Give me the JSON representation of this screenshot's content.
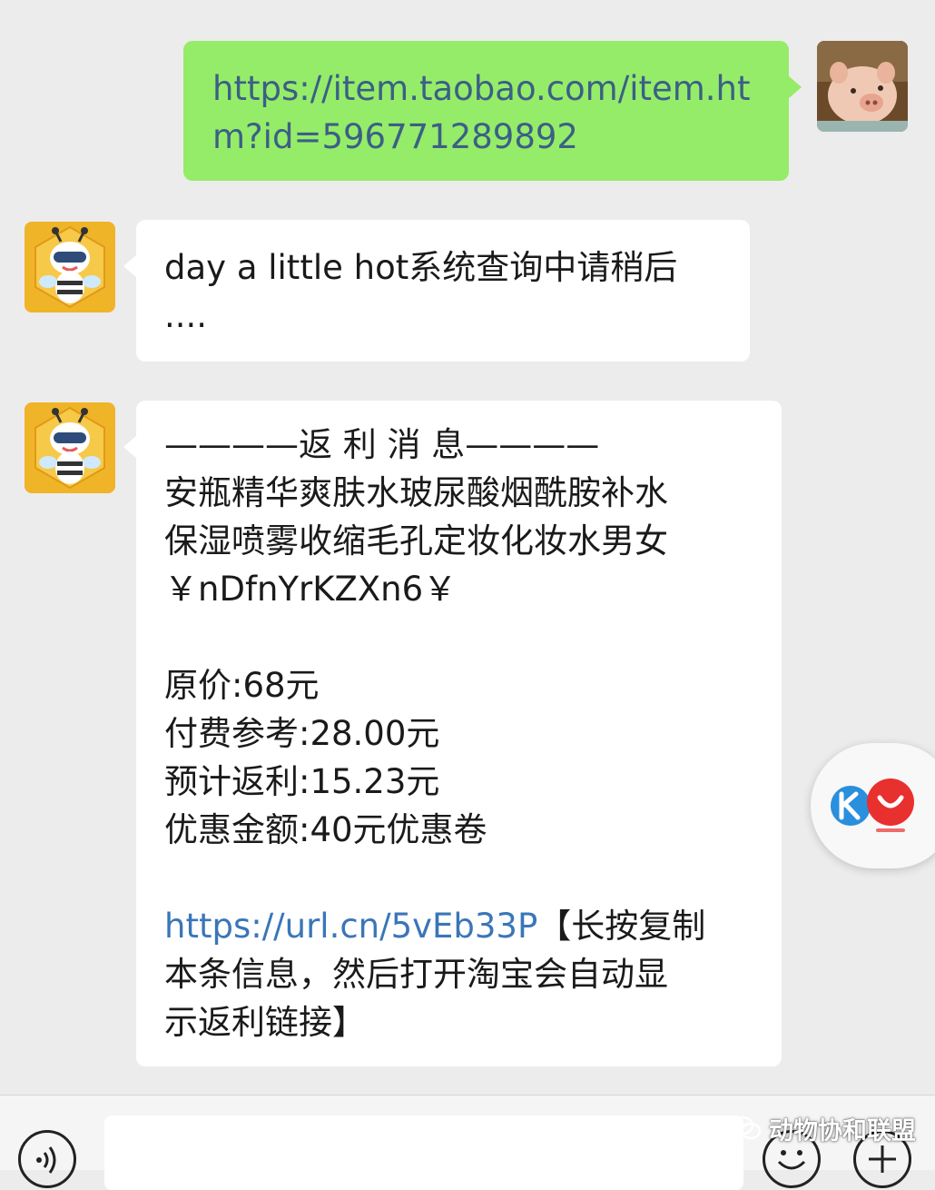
{
  "messages": [
    {
      "sender": "me",
      "lines": [
        "https://item.taobao.com/item.ht",
        "m?id=596771289892"
      ]
    },
    {
      "sender": "bot",
      "lines": [
        "day a little hot系统查询中请稍后",
        "...."
      ]
    },
    {
      "sender": "bot",
      "header": "————返 利 消 息————",
      "product_lines": [
        "安瓶精华爽肤水玻尿酸烟酰胺补水",
        "保湿喷雾收缩毛孔定妆化妆水男女",
        "￥nDfnYrKZXn6￥"
      ],
      "price_lines": [
        "原价:68元",
        "付费参考:28.00元",
        "预计返利:15.23元",
        "优惠金额:40元优惠卷"
      ],
      "link": "https://url.cn/5vEb33P",
      "after_link": "【长按复制",
      "footer_lines": [
        "本条信息，然后打开淘宝会自动显",
        "示返利链接】"
      ]
    }
  ],
  "icons": {
    "me_avatar": "pig-avatar-icon",
    "bot_avatar": "bee-robot-avatar-icon",
    "float": "kk-app-float-icon",
    "voice": "voice-icon",
    "emoji": "emoji-icon",
    "plus": "plus-icon",
    "watermark": "wechat-official-icon"
  },
  "watermark": {
    "text": "动物协和联盟"
  },
  "colors": {
    "background": "#ececec",
    "my_bubble": "#95ec69",
    "bot_bubble": "#ffffff",
    "link": "#3a76b8"
  }
}
